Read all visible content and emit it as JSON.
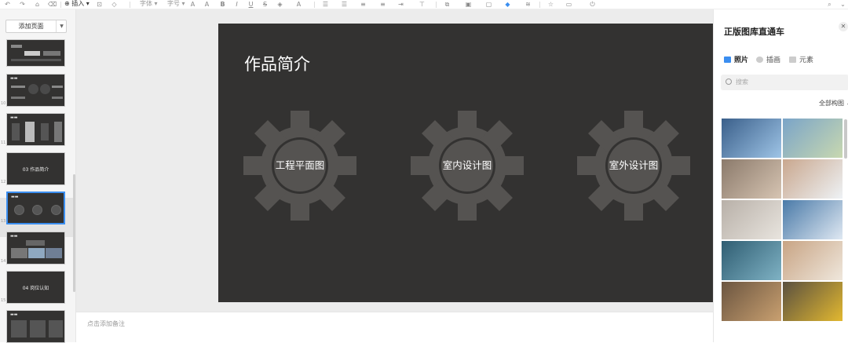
{
  "toolbar": {
    "insert_label": "插入",
    "font_label": "字体",
    "size_label": "字号"
  },
  "left_panel": {
    "add_page_label": "添加页面",
    "thumbnails": [
      {
        "num": "",
        "title": ""
      },
      {
        "num": "10",
        "title": ""
      },
      {
        "num": "11",
        "title": ""
      },
      {
        "num": "12",
        "title": "03  作品简介"
      },
      {
        "num": "13",
        "title": ""
      },
      {
        "num": "14",
        "title": ""
      },
      {
        "num": "15",
        "title": "04  岗位认知"
      },
      {
        "num": "16",
        "title": ""
      }
    ]
  },
  "slide": {
    "title": "作品简介",
    "gears": [
      "工程平面图",
      "室内设计图",
      "室外设计图"
    ]
  },
  "notes": {
    "placeholder": "点击添加备注"
  },
  "right_panel": {
    "title": "正版图库直通车",
    "tabs": [
      {
        "label": "照片",
        "icon": "photo-icon",
        "active": true
      },
      {
        "label": "插画",
        "icon": "palette-icon",
        "active": false
      },
      {
        "label": "元素",
        "icon": "grid-icon",
        "active": false
      }
    ],
    "search_placeholder": "搜索",
    "filter_label": "全部构图",
    "photos": [
      {
        "subject": "scientist-lab",
        "colors": [
          "#3a5f8a",
          "#9ec4e6"
        ]
      },
      {
        "subject": "family-bikes",
        "colors": [
          "#7aa4c8",
          "#c8d8b0"
        ]
      },
      {
        "subject": "family-sofa",
        "colors": [
          "#8b7a6b",
          "#d6c4b2"
        ]
      },
      {
        "subject": "girl-dentist",
        "colors": [
          "#c9a78e",
          "#eef2f5"
        ]
      },
      {
        "subject": "elderly-care",
        "colors": [
          "#b8b0a8",
          "#e8e4de"
        ]
      },
      {
        "subject": "mountains",
        "colors": [
          "#4a7aa8",
          "#dfe8f2"
        ]
      },
      {
        "subject": "surgery",
        "colors": [
          "#2f5d72",
          "#7fb2c4"
        ]
      },
      {
        "subject": "child-sleeping",
        "colors": [
          "#c8a484",
          "#efe7dc"
        ]
      },
      {
        "subject": "workshop",
        "colors": [
          "#6b5540",
          "#c9a070"
        ]
      },
      {
        "subject": "construction-worker",
        "colors": [
          "#5a5040",
          "#e2b830"
        ]
      }
    ]
  }
}
